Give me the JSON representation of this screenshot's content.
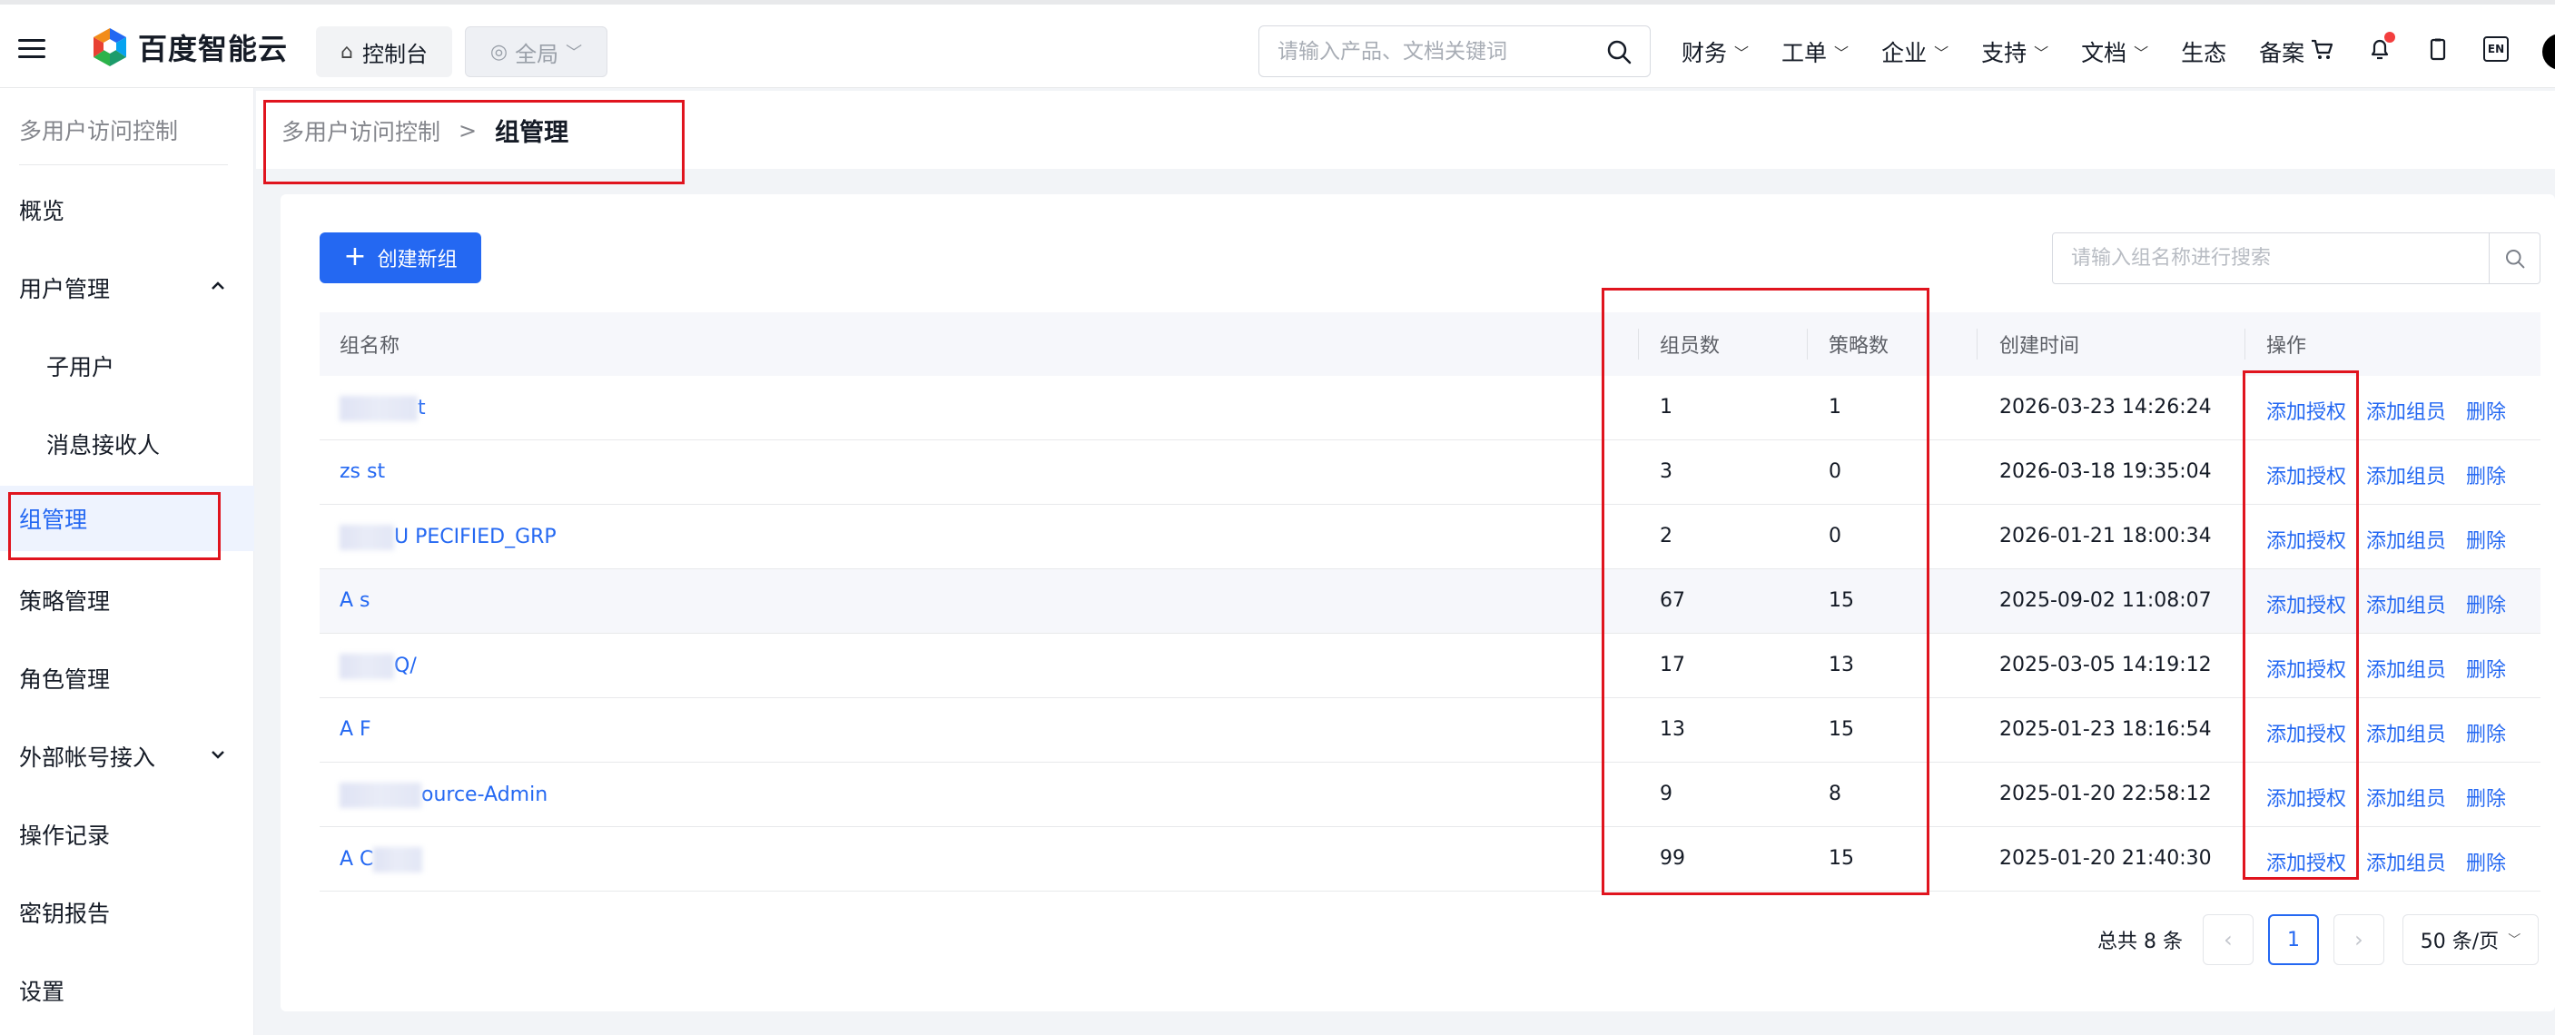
{
  "topbar": {
    "brand": "百度智能云",
    "console_label": "控制台",
    "region_label": "全局",
    "search_placeholder": "请输入产品、文档关键词",
    "nav": [
      {
        "label": "财务",
        "has_dropdown": true
      },
      {
        "label": "工单",
        "has_dropdown": true
      },
      {
        "label": "企业",
        "has_dropdown": true
      },
      {
        "label": "支持",
        "has_dropdown": true
      },
      {
        "label": "文档",
        "has_dropdown": true
      },
      {
        "label": "生态",
        "has_dropdown": false
      },
      {
        "label": "备案",
        "has_dropdown": false
      }
    ],
    "icons": [
      "cart-icon",
      "bell-icon",
      "clipboard-icon",
      "language-icon"
    ],
    "lang_label": "EN"
  },
  "sidebar": {
    "title": "多用户访问控制",
    "items": [
      {
        "label": "概览"
      },
      {
        "label": "用户管理",
        "expanded": true
      },
      {
        "label": "子用户",
        "sub": true
      },
      {
        "label": "消息接收人",
        "sub": true
      },
      {
        "label": "组管理",
        "active": true
      },
      {
        "label": "策略管理"
      },
      {
        "label": "角色管理"
      },
      {
        "label": "外部帐号接入",
        "expanded": false
      },
      {
        "label": "操作记录"
      },
      {
        "label": "密钥报告"
      },
      {
        "label": "设置"
      }
    ]
  },
  "breadcrumb": {
    "parent": "多用户访问控制",
    "separator": ">",
    "current": "组管理"
  },
  "toolbar": {
    "create_label": "创建新组",
    "search_placeholder": "请输入组名称进行搜索"
  },
  "table": {
    "columns": [
      "组名称",
      "组员数",
      "策略数",
      "创建时间",
      "操作"
    ],
    "actions": [
      "添加授权",
      "添加组员",
      "删除"
    ],
    "rows": [
      {
        "name": "t",
        "members": "1",
        "policies": "1",
        "created": "2026-03-23 14:26:24"
      },
      {
        "name": "zs st",
        "members": "3",
        "policies": "0",
        "created": "2026-03-18 19:35:04"
      },
      {
        "name": "U PECIFIED_GRP",
        "members": "2",
        "policies": "0",
        "created": "2026-01-21 18:00:34"
      },
      {
        "name": "A s",
        "members": "67",
        "policies": "15",
        "created": "2025-09-02 11:08:07"
      },
      {
        "name": "Q/",
        "members": "17",
        "policies": "13",
        "created": "2025-03-05 14:19:12"
      },
      {
        "name": "A F",
        "members": "13",
        "policies": "15",
        "created": "2025-01-23 18:16:54"
      },
      {
        "name": "ource-Admin",
        "members": "9",
        "policies": "8",
        "created": "2025-01-20 22:58:12"
      },
      {
        "name": "A C",
        "members": "99",
        "policies": "15",
        "created": "2025-01-20 21:40:30"
      }
    ]
  },
  "pagination": {
    "total": "总共 8 条",
    "current_page": "1",
    "page_size": "50 条/页"
  },
  "colors": {
    "primary": "#2468f2",
    "highlight": "#e0141e"
  }
}
